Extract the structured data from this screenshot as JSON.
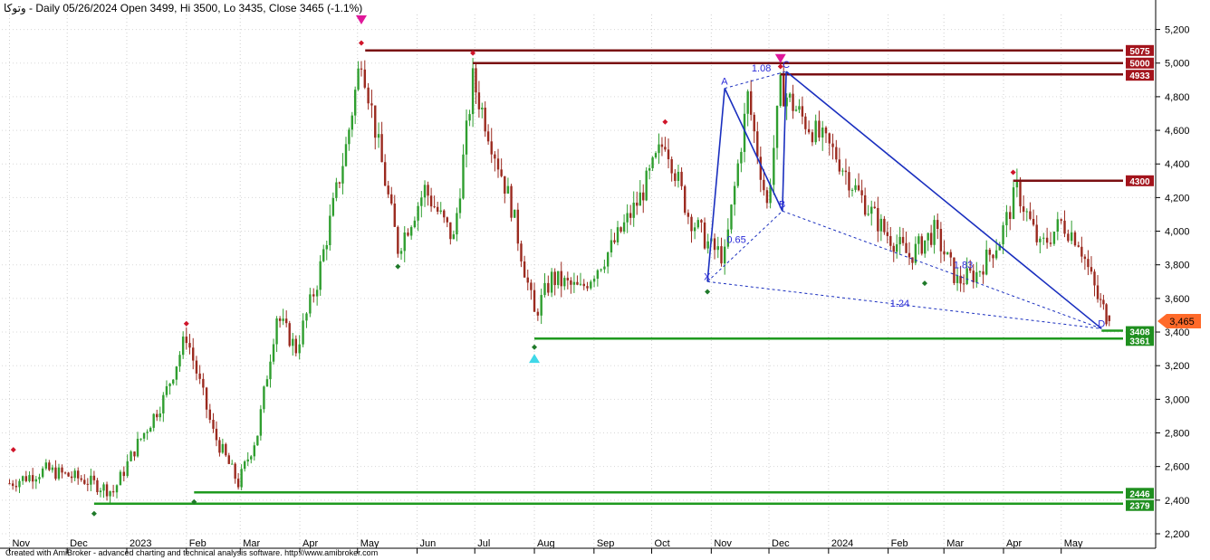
{
  "header": {
    "symbol": "وتوکا",
    "info": "- Daily 05/26/2024 Open 3499, Hi 3500, Lo 3435, Close 3465 (-1.1%)"
  },
  "footer": {
    "credit": "Created with AmiBroker - advanced charting and technical analysis software. http://www.amibroker.com"
  },
  "colors": {
    "up": "#2f9e2f",
    "down": "#9b2a1f",
    "resistance": "#7a0f12",
    "support": "#1f9a1f",
    "harmonic": "#1a2fbf",
    "last_price_tag": "#ff6a2a",
    "high_marker": "#e0189a",
    "low_marker": "#3fd8e8"
  },
  "chart_data": {
    "type": "candlestick",
    "ylim": [
      2200,
      5300
    ],
    "y_ticks": [
      "5,200",
      "5,000",
      "4,800",
      "4,600",
      "4,400",
      "4,200",
      "4,000",
      "3,800",
      "3,600",
      "3,400",
      "3,200",
      "3,000",
      "2,800",
      "2,600",
      "2,400",
      "2,200"
    ],
    "x_labels": [
      "Nov",
      "Dec",
      "2023",
      "Feb",
      "Mar",
      "Apr",
      "May",
      "Jun",
      "Jul",
      "Aug",
      "Sep",
      "Oct",
      "Nov",
      "Dec",
      "2024",
      "Feb",
      "Mar",
      "Apr",
      "May"
    ],
    "grid": true,
    "last_price": 3465,
    "last_price_label": "3,465",
    "price_path": [
      {
        "date": "2022-11",
        "close": 2500
      },
      {
        "date": "2022-11-20",
        "close": 2580
      },
      {
        "date": "2022-12-10",
        "close": 2520
      },
      {
        "date": "2022-12-25",
        "close": 2450
      },
      {
        "date": "2023-01-05",
        "close": 2700
      },
      {
        "date": "2023-01-20",
        "close": 3000
      },
      {
        "date": "2023-02-01",
        "close": 3380
      },
      {
        "date": "2023-02-15",
        "close": 2800
      },
      {
        "date": "2023-02-28",
        "close": 2500
      },
      {
        "date": "2023-03-10",
        "close": 2800
      },
      {
        "date": "2023-03-20",
        "close": 3500
      },
      {
        "date": "2023-03-30",
        "close": 3300
      },
      {
        "date": "2023-04-10",
        "close": 3700
      },
      {
        "date": "2023-04-25",
        "close": 4500
      },
      {
        "date": "2023-05-03",
        "close": 5050
      },
      {
        "date": "2023-05-12",
        "close": 4500
      },
      {
        "date": "2023-05-22",
        "close": 3900
      },
      {
        "date": "2023-06-05",
        "close": 4250
      },
      {
        "date": "2023-06-20",
        "close": 3950
      },
      {
        "date": "2023-06-30",
        "close": 4900
      },
      {
        "date": "2023-07-08",
        "close": 4600
      },
      {
        "date": "2023-07-20",
        "close": 4150
      },
      {
        "date": "2023-08-01",
        "close": 3500
      },
      {
        "date": "2023-08-10",
        "close": 3720
      },
      {
        "date": "2023-08-25",
        "close": 3650
      },
      {
        "date": "2023-09-10",
        "close": 3900
      },
      {
        "date": "2023-09-25",
        "close": 4200
      },
      {
        "date": "2023-10-08",
        "close": 4550
      },
      {
        "date": "2023-10-20",
        "close": 4100
      },
      {
        "date": "2023-11-01",
        "close": 3900
      },
      {
        "date": "2023-11-08",
        "close": 3850
      },
      {
        "date": "2023-11-20",
        "close": 4800
      },
      {
        "date": "2023-11-30",
        "close": 4150
      },
      {
        "date": "2023-12-07",
        "close": 4850
      },
      {
        "date": "2023-12-20",
        "close": 4650
      },
      {
        "date": "2024-01-05",
        "close": 4450
      },
      {
        "date": "2024-01-15",
        "close": 4250
      },
      {
        "date": "2024-01-30",
        "close": 4000
      },
      {
        "date": "2024-02-12",
        "close": 3850
      },
      {
        "date": "2024-02-25",
        "close": 4000
      },
      {
        "date": "2024-03-08",
        "close": 3700
      },
      {
        "date": "2024-03-18",
        "close": 3750
      },
      {
        "date": "2024-03-30",
        "close": 3950
      },
      {
        "date": "2024-04-08",
        "close": 4250
      },
      {
        "date": "2024-04-20",
        "close": 3900
      },
      {
        "date": "2024-05-01",
        "close": 4050
      },
      {
        "date": "2024-05-10",
        "close": 3950
      },
      {
        "date": "2024-05-20",
        "close": 3600
      },
      {
        "date": "2024-05-26",
        "close": 3465
      }
    ],
    "resistance_levels": [
      {
        "value": 5075,
        "label": "5075"
      },
      {
        "value": 5000,
        "label": "5000"
      },
      {
        "value": 4933,
        "label": "4933"
      },
      {
        "value": 4300,
        "label": "4300"
      }
    ],
    "support_levels": [
      {
        "value": 3408,
        "label": "3408"
      },
      {
        "value": 3361,
        "label": "3361"
      },
      {
        "value": 2446,
        "label": "2446"
      },
      {
        "value": 2379,
        "label": "2379"
      }
    ],
    "harmonic_pattern": {
      "points": [
        {
          "label": "X",
          "date": "2023-10-30",
          "price": 3700
        },
        {
          "label": "A",
          "date": "2023-11-08",
          "price": 4850
        },
        {
          "label": "B",
          "date": "2023-12-08",
          "price": 4120
        },
        {
          "label": "C",
          "date": "2023-12-10",
          "price": 4950
        },
        {
          "label": "D",
          "date": "2024-05-22",
          "price": 3420
        }
      ],
      "ratios": [
        {
          "label": "0.65",
          "price": 3930
        },
        {
          "label": "1.08",
          "price": 4950
        },
        {
          "label": "1.83",
          "price": 3780
        },
        {
          "label": "1.24",
          "price": 3550
        }
      ]
    }
  }
}
